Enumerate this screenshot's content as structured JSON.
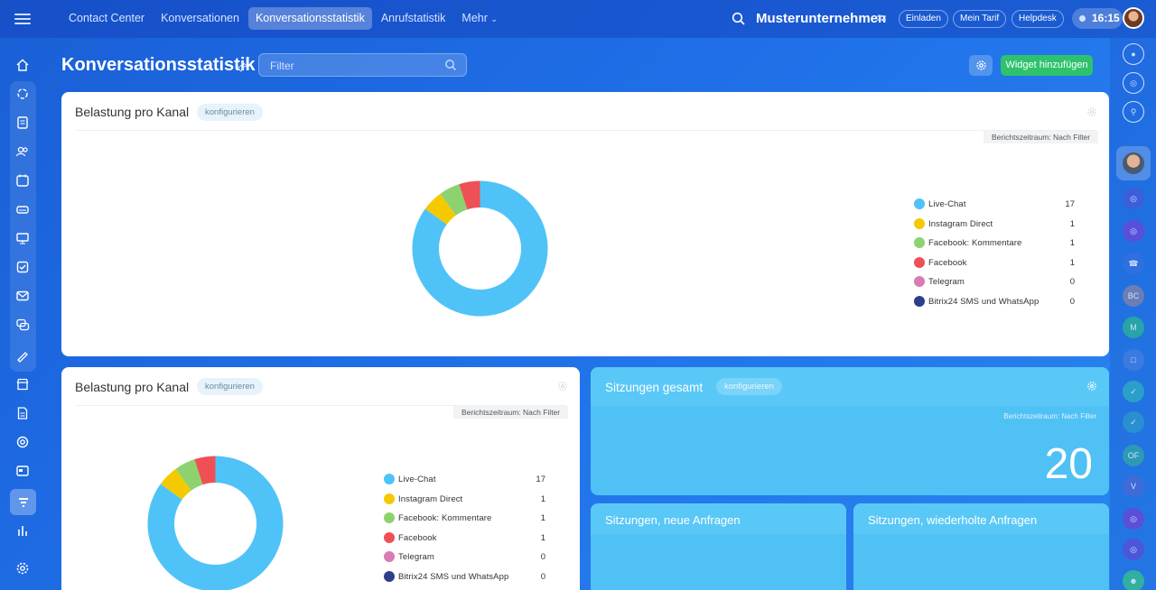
{
  "topbar": {
    "tabs": [
      "Contact Center",
      "Konversationen",
      "Konversationsstatistik",
      "Anrufstatistik",
      "Mehr"
    ],
    "active_tab": 2,
    "company": "Musterunternehmen",
    "buttons": [
      "Einladen",
      "Mein Tarif",
      "Helpdesk"
    ],
    "time": "16:15"
  },
  "page": {
    "title": "Konversationsstatistik",
    "filter_placeholder": "Filter",
    "add_widget": "Widget hinzufügen"
  },
  "widgets": {
    "load1": {
      "title": "Belastung pro Kanal",
      "configure": "konfigurieren",
      "period": "Berichtszeitraum: Nach Filter"
    },
    "load2": {
      "title": "Belastung pro Kanal",
      "configure": "konfigurieren",
      "period": "Berichtszeitraum: Nach Filter"
    },
    "sessions_total": {
      "title": "Sitzungen gesamt",
      "configure": "konfigurieren",
      "period": "Berichtszeitraum: Nach Filter",
      "value": "20"
    },
    "sessions_new": {
      "title": "Sitzungen, neue Anfragen"
    },
    "sessions_repeat": {
      "title": "Sitzungen, wiederholte Anfragen"
    }
  },
  "chart_data": [
    {
      "type": "pie",
      "title": "Belastung pro Kanal",
      "categories": [
        "Live-Chat",
        "Instagram Direct",
        "Facebook: Kommentare",
        "Facebook",
        "Telegram",
        "Bitrix24 SMS und WhatsApp"
      ],
      "values": [
        17,
        1,
        1,
        1,
        0,
        0
      ],
      "colors": [
        "#4fc3f7",
        "#f5c900",
        "#8dd26e",
        "#ef5056",
        "#d97bb5",
        "#2d3f8a"
      ],
      "legend": "right"
    },
    {
      "type": "pie",
      "title": "Belastung pro Kanal",
      "categories": [
        "Live-Chat",
        "Instagram Direct",
        "Facebook: Kommentare",
        "Facebook",
        "Telegram",
        "Bitrix24 SMS und WhatsApp"
      ],
      "values": [
        17,
        1,
        1,
        1,
        0,
        0
      ],
      "colors": [
        "#4fc3f7",
        "#f5c900",
        "#8dd26e",
        "#ef5056",
        "#d97bb5",
        "#2d3f8a"
      ],
      "legend": "right"
    }
  ],
  "right_sidebar": {
    "initials": [
      "BC",
      "M",
      "OF",
      "V"
    ]
  }
}
